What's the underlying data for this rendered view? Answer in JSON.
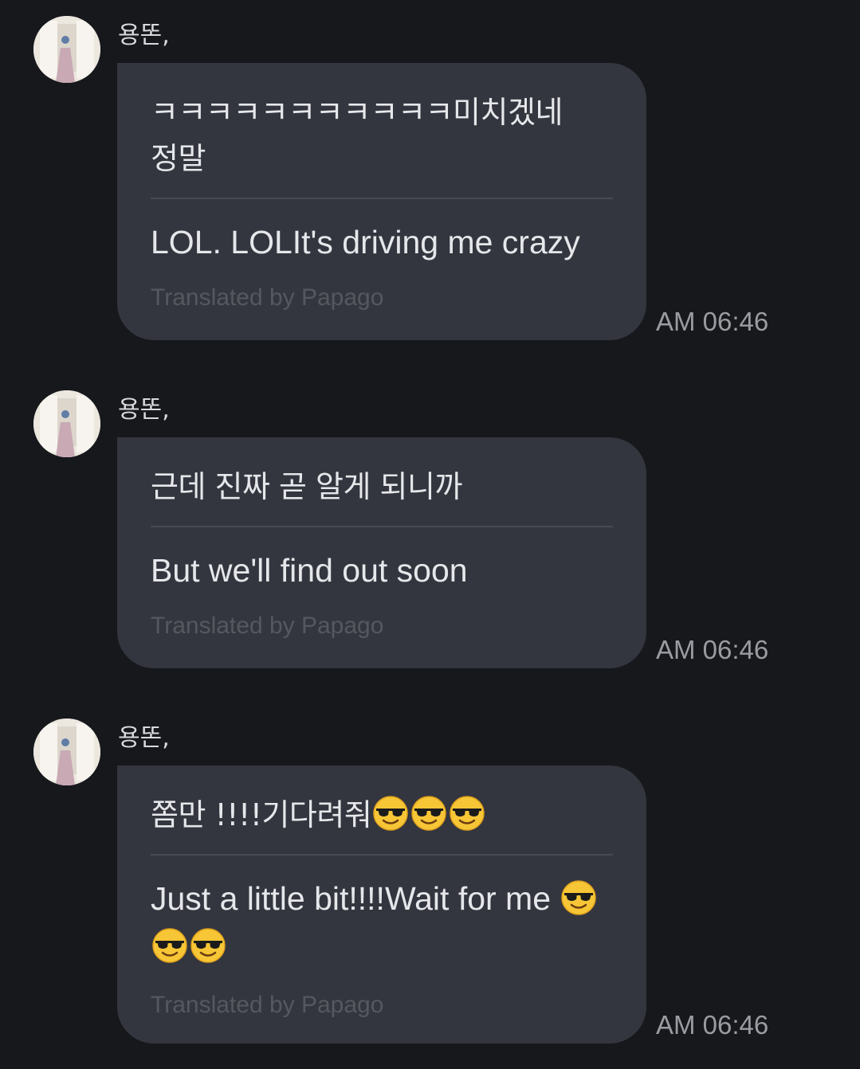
{
  "messages": [
    {
      "sender": "용똔,",
      "original": "ㅋㅋㅋㅋㅋㅋㅋㅋㅋㅋㅋ미치겠네 정말",
      "original_emoji": 0,
      "translated": "LOL. LOLIt's driving me crazy",
      "translated_emoji": 0,
      "credit": "Translated by Papago",
      "time": "AM 06:46"
    },
    {
      "sender": "용똔,",
      "original": "근데 진짜 곧 알게 되니까",
      "original_emoji": 0,
      "translated": "But we'll find out soon",
      "translated_emoji": 0,
      "credit": "Translated by Papago",
      "time": "AM 06:46"
    },
    {
      "sender": "용똔,",
      "original": "쫌만 !!!!기다려줘",
      "original_emoji": 3,
      "translated": "Just a little bit!!!!Wait for me",
      "translated_emoji": 3,
      "credit": "Translated by Papago",
      "time": "AM 06:46"
    }
  ],
  "icons": {
    "emoji": "smiling-face-with-sunglasses-icon",
    "avatar": "profile-photo"
  },
  "colors": {
    "background": "#17181c",
    "bubble": "#34363f",
    "text": "#e6e7ea",
    "credit": "#55585f",
    "time": "#9a9ca2"
  }
}
